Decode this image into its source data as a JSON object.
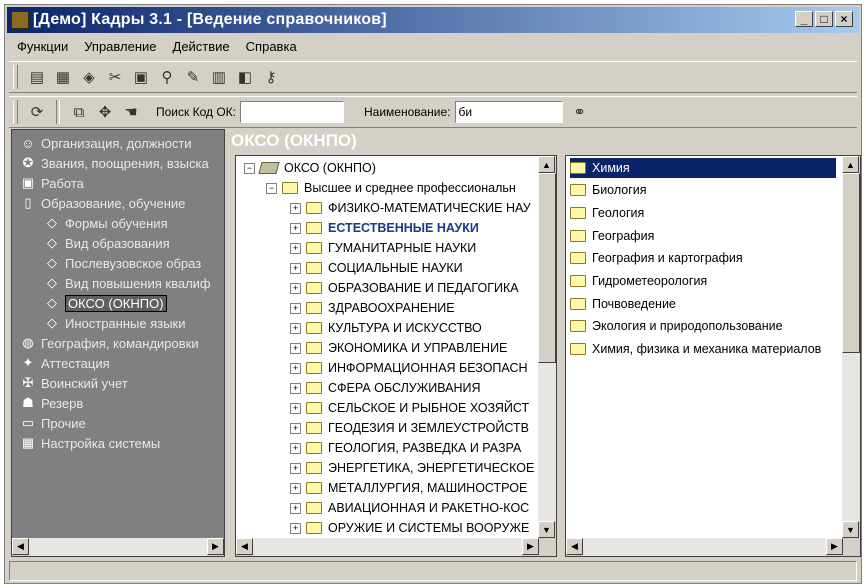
{
  "window": {
    "title": "[Демо] Кадры 3.1 - [Ведение справочников]"
  },
  "menu": [
    {
      "label": "Функции"
    },
    {
      "label": "Управление"
    },
    {
      "label": "Действие"
    },
    {
      "label": "Справка"
    }
  ],
  "toolbar2": {
    "search_code_label": "Поиск Код ОК:",
    "search_code_value": "",
    "name_label": "Наименование:",
    "name_value": "би"
  },
  "nav": [
    {
      "label": "Организация, должности",
      "icon": "people-icon"
    },
    {
      "label": "Звания, поощрения, взыска",
      "icon": "medal-icon"
    },
    {
      "label": "Работа",
      "icon": "briefcase-icon"
    },
    {
      "label": "Образование, обучение",
      "icon": "document-icon"
    },
    {
      "label": "Формы обучения",
      "icon": "book-icon"
    },
    {
      "label": "Вид образования",
      "icon": "book-icon"
    },
    {
      "label": "Послевузовское образ",
      "icon": "book-icon"
    },
    {
      "label": "Вид повышения квалиф",
      "icon": "book-icon"
    },
    {
      "label": "ОКСО (ОКНПО)",
      "icon": "book-icon"
    },
    {
      "label": "Иностранные языки",
      "icon": "book-icon"
    },
    {
      "label": "География, командировки",
      "icon": "globe-icon"
    },
    {
      "label": "Аттестация",
      "icon": "certificate-icon"
    },
    {
      "label": "Воинский учет",
      "icon": "military-icon"
    },
    {
      "label": "Резерв",
      "icon": "reserve-icon"
    },
    {
      "label": "Прочие",
      "icon": "folder-icon"
    },
    {
      "label": "Настройка системы",
      "icon": "settings-icon"
    }
  ],
  "header": {
    "title": "ОКСО (ОКНПО)"
  },
  "tree": {
    "root": "ОКСО (ОКНПО)",
    "child": "Высшее и среднее профессиональн",
    "items": [
      "ФИЗИКО-МАТЕМАТИЧЕСКИЕ НАУ",
      "ЕСТЕСТВЕННЫЕ НАУКИ",
      "ГУМАНИТАРНЫЕ НАУКИ",
      "СОЦИАЛЬНЫЕ НАУКИ",
      "ОБРАЗОВАНИЕ И ПЕДАГОГИКА",
      "ЗДРАВООХРАНЕНИЕ",
      "КУЛЬТУРА И ИСКУССТВО",
      "ЭКОНОМИКА И УПРАВЛЕНИЕ",
      "ИНФОРМАЦИОННАЯ БЕЗОПАСН",
      "СФЕРА ОБСЛУЖИВАНИЯ",
      "СЕЛЬСКОЕ И РЫБНОЕ ХОЗЯЙСТ",
      "ГЕОДЕЗИЯ И ЗЕМЛЕУСТРОЙСТВ",
      "ГЕОЛОГИЯ, РАЗВЕДКА И РАЗРА",
      "ЭНЕРГЕТИКА, ЭНЕРГЕТИЧЕСКОЕ",
      "МЕТАЛЛУРГИЯ, МАШИНОСТРОЕ",
      "АВИАЦИОННАЯ И РАКЕТНО-КОС",
      "ОРУЖИЕ И СИСТЕМЫ ВООРУЖЕ"
    ]
  },
  "list": {
    "items": [
      "Химия",
      "Биология",
      "Геология",
      "География",
      "География и картография",
      "Гидрометеорология",
      "Почвоведение",
      "Экология и природопользование",
      "Химия, физика и механика материалов"
    ]
  }
}
